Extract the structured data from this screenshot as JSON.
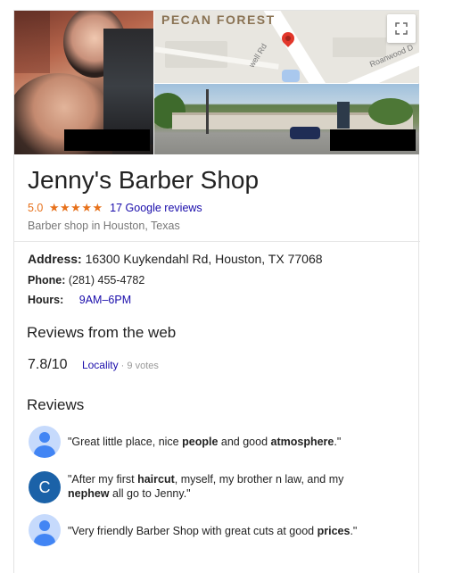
{
  "header": {
    "map_place_label": "PECAN FOREST",
    "map_road_label_1": "well Rd",
    "map_road_label_2": "Roanwood D"
  },
  "business": {
    "name": "Jenny's Barber Shop",
    "rating": "5.0",
    "stars": "★★★★★",
    "reviews_link": "17 Google reviews",
    "category": "Barber shop in Houston, Texas"
  },
  "details": {
    "address_label": "Address:",
    "address_value": "16300 Kuykendahl Rd, Houston, TX 77068",
    "phone_label": "Phone:",
    "phone_value": "(281) 455-4782",
    "hours_label": "Hours:",
    "hours_value": "9AM–6PM"
  },
  "web_reviews": {
    "heading": "Reviews from the web",
    "score": "7.8/10",
    "source": "Locality",
    "votes": " · 9 votes"
  },
  "reviews": {
    "heading": "Reviews",
    "items": [
      {
        "avatar": "person-icon",
        "parts": [
          "\"Great little place, nice ",
          "people",
          " and good ",
          "atmosphere",
          ".\""
        ]
      },
      {
        "avatar_letter": "C",
        "line1_parts": [
          "\"After my first ",
          "haircut",
          ", myself, my brother n law, and my"
        ],
        "line2_parts": [
          "nephew",
          " all go to Jenny.\""
        ]
      },
      {
        "avatar": "person-icon",
        "parts": [
          "\"Very friendly Barber Shop with great cuts at good ",
          "prices",
          ".\""
        ]
      }
    ]
  },
  "colors": {
    "star": "#e7711b",
    "link": "#1a0dab",
    "avatar_letter_bg": "#1b62a8"
  }
}
